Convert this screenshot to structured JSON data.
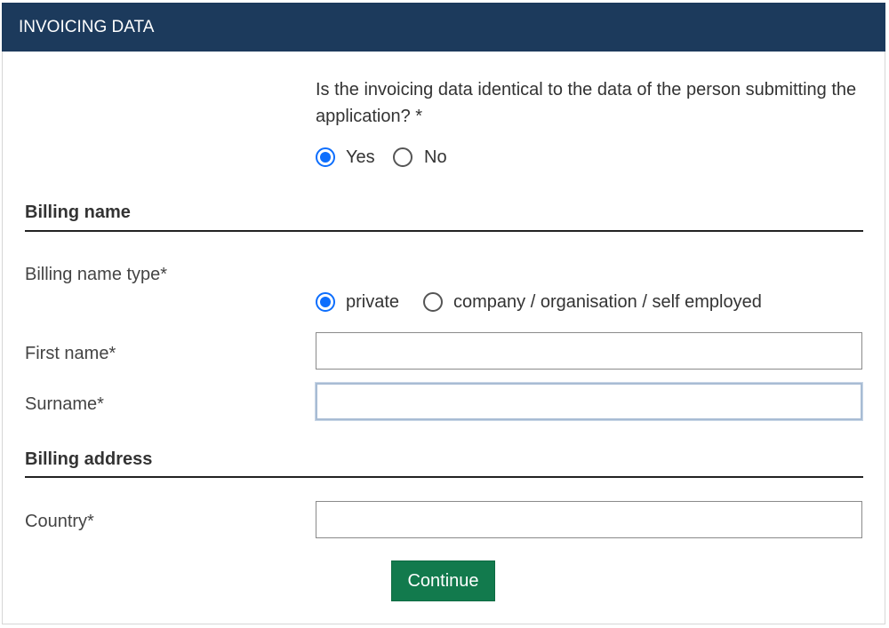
{
  "header": {
    "title": "INVOICING DATA"
  },
  "identical_question": {
    "text": "Is the invoicing data identical to the data of the person submitting the application?  *",
    "options": [
      {
        "label": "Yes",
        "checked": true
      },
      {
        "label": "No",
        "checked": false
      }
    ]
  },
  "billing_name": {
    "section_title": "Billing name",
    "type_label": "Billing name type*",
    "type_options": [
      {
        "label": "private",
        "checked": true
      },
      {
        "label": "company / organisation / self employed",
        "checked": false
      }
    ],
    "first_name_label": "First name*",
    "first_name_value": "",
    "surname_label": "Surname*",
    "surname_value": ""
  },
  "billing_address": {
    "section_title": "Billing address",
    "country_label": "Country*",
    "country_value": ""
  },
  "actions": {
    "continue_label": "Continue"
  },
  "colors": {
    "header_bg": "#1c3a5c",
    "radio_accent": "#0d6efd",
    "continue_bg": "#127a4d"
  }
}
